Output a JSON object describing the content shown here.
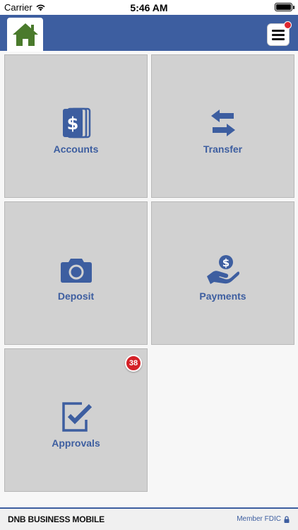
{
  "status_bar": {
    "carrier": "Carrier",
    "time": "5:46 AM",
    "icons": [
      "wifi-icon",
      "battery-icon"
    ]
  },
  "nav": {
    "home_icon": "home-icon",
    "menu_icon": "hamburger-menu-icon",
    "menu_notification": true,
    "brand_color": "#3d5ea0"
  },
  "tiles": [
    {
      "label": "Accounts",
      "icon": "dollar-cards-icon"
    },
    {
      "label": "Transfer",
      "icon": "transfer-arrows-icon"
    },
    {
      "label": "Deposit",
      "icon": "camera-icon"
    },
    {
      "label": "Payments",
      "icon": "hand-coin-icon"
    },
    {
      "label": "Approvals",
      "icon": "approval-check-icon",
      "badge": "38"
    }
  ],
  "footer": {
    "brand": "DNB BUSINESS MOBILE",
    "fdic": "Member FDIC",
    "fdic_icon": "lock-icon"
  },
  "colors": {
    "accent": "#3d5ea0",
    "home_green": "#4a7a2c",
    "badge_red": "#d42128",
    "tile_bg": "#d1d1d1"
  }
}
